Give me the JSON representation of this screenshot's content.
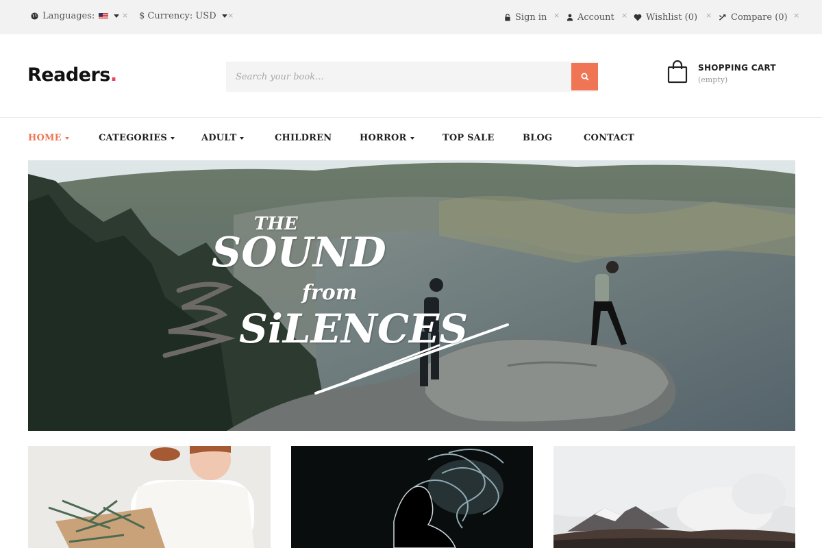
{
  "topbar": {
    "languages_label": "Languages:",
    "currency_label": "$ Currency: USD",
    "sign_in": "Sign in",
    "account": "Account",
    "wishlist": "Wishlist (0)",
    "compare": "Compare (0)",
    "separator": "×"
  },
  "header": {
    "logo_text": "Readers",
    "logo_dot": ".",
    "search_placeholder": "Search your book...",
    "cart_title": "SHOPPING CART",
    "cart_status": "(empty)"
  },
  "nav": {
    "items": [
      {
        "label": "HOME",
        "has_dropdown": true,
        "active": true
      },
      {
        "label": "CATEGORIES",
        "has_dropdown": true,
        "active": false
      },
      {
        "label": "ADULT",
        "has_dropdown": true,
        "active": false
      },
      {
        "label": "CHILDREN",
        "has_dropdown": false,
        "active": false
      },
      {
        "label": "HORROR",
        "has_dropdown": true,
        "active": false
      },
      {
        "label": "TOP SALE",
        "has_dropdown": false,
        "active": false
      },
      {
        "label": "BLOG",
        "has_dropdown": false,
        "active": false
      },
      {
        "label": "CONTACT",
        "has_dropdown": false,
        "active": false
      }
    ]
  },
  "hero": {
    "line1": "THE",
    "line2": "SOUND",
    "line3": "from",
    "line4": "SiLENCES"
  },
  "colors": {
    "accent": "#ef7554",
    "logo_dot": "#e8405d",
    "topbar_bg": "#f2f2f2"
  },
  "icons": {
    "languages": "globe-icon",
    "sign_in": "lock-icon",
    "account": "user-icon",
    "wishlist": "heart-icon",
    "compare": "shuffle-icon",
    "search": "search-icon",
    "cart": "shopping-bag-icon"
  }
}
